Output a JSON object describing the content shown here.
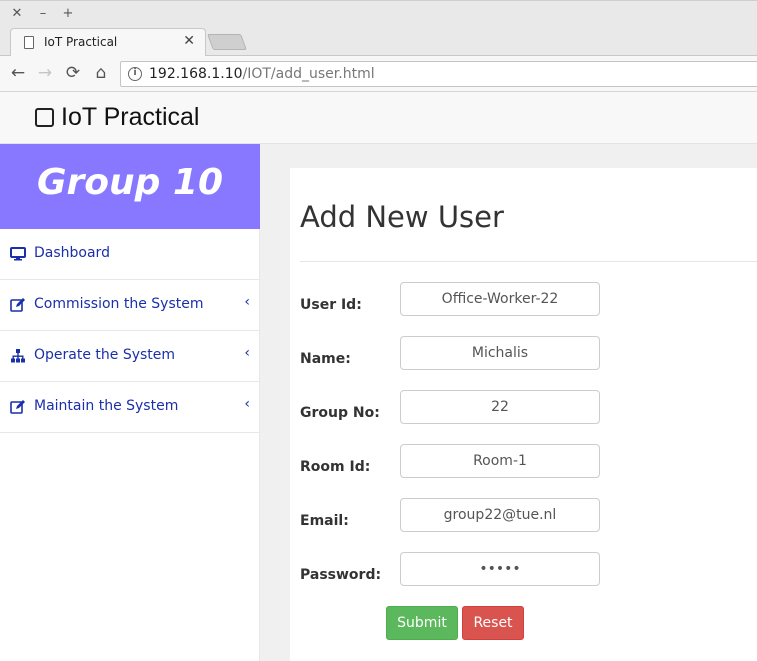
{
  "browser": {
    "window_controls": {
      "close": "✕",
      "minimize": "–",
      "maximize": "+"
    },
    "tab": {
      "title": "IoT Practical",
      "close": "✕"
    },
    "url": {
      "host": "192.168.1.10",
      "path": "/IOT/add_user.html"
    }
  },
  "navbar": {
    "brand": "IoT Practical"
  },
  "sidebar": {
    "group": "Group 10",
    "items": [
      {
        "label": "Dashboard",
        "icon": "desktop-icon",
        "has_submenu": false
      },
      {
        "label": "Commission the System",
        "icon": "edit-icon",
        "has_submenu": true
      },
      {
        "label": "Operate the System",
        "icon": "sitemap-icon",
        "has_submenu": true
      },
      {
        "label": "Maintain the System",
        "icon": "edit-icon",
        "has_submenu": true
      }
    ],
    "chevron": "‹"
  },
  "form": {
    "title": "Add New User",
    "fields": [
      {
        "label": "User Id:",
        "value": "Office-Worker-22"
      },
      {
        "label": "Name:",
        "value": "Michalis"
      },
      {
        "label": "Group No:",
        "value": "22"
      },
      {
        "label": "Room Id:",
        "value": "Room-1"
      },
      {
        "label": "Email:",
        "value": "group22@tue.nl"
      },
      {
        "label": "Password:",
        "value": "•••••"
      }
    ],
    "submit_label": "Submit",
    "reset_label": "Reset"
  },
  "colors": {
    "group_banner": "#8878ff",
    "link": "#1a2faa",
    "submit": "#5cb85c",
    "reset": "#d9534f"
  }
}
